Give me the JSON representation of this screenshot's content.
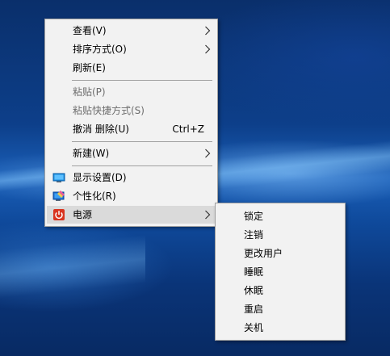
{
  "context_menu": {
    "items": [
      {
        "label": "查看(V)"
      },
      {
        "label": "排序方式(O)"
      },
      {
        "label": "刷新(E)"
      },
      {
        "label": "粘贴(P)"
      },
      {
        "label": "粘贴快捷方式(S)"
      },
      {
        "label": "撤消 删除(U)",
        "shortcut": "Ctrl+Z"
      },
      {
        "label": "新建(W)"
      },
      {
        "label": "显示设置(D)"
      },
      {
        "label": "个性化(R)"
      },
      {
        "label": "电源"
      }
    ]
  },
  "power_submenu": {
    "items": [
      {
        "label": "锁定"
      },
      {
        "label": "注销"
      },
      {
        "label": "更改用户"
      },
      {
        "label": "睡眠"
      },
      {
        "label": "休眠"
      },
      {
        "label": "重启"
      },
      {
        "label": "关机"
      }
    ]
  },
  "icons": {
    "submenu_arrow": "chevron-right-icon",
    "display_settings": "display-settings-icon",
    "personalize": "personalize-icon",
    "power": "power-icon"
  },
  "colors": {
    "menu_background": "#f2f2f2",
    "menu_border": "#a0a0a0",
    "highlight": "#dadada",
    "disabled_text": "#6d6d6d",
    "power_icon": "#d9341f"
  }
}
